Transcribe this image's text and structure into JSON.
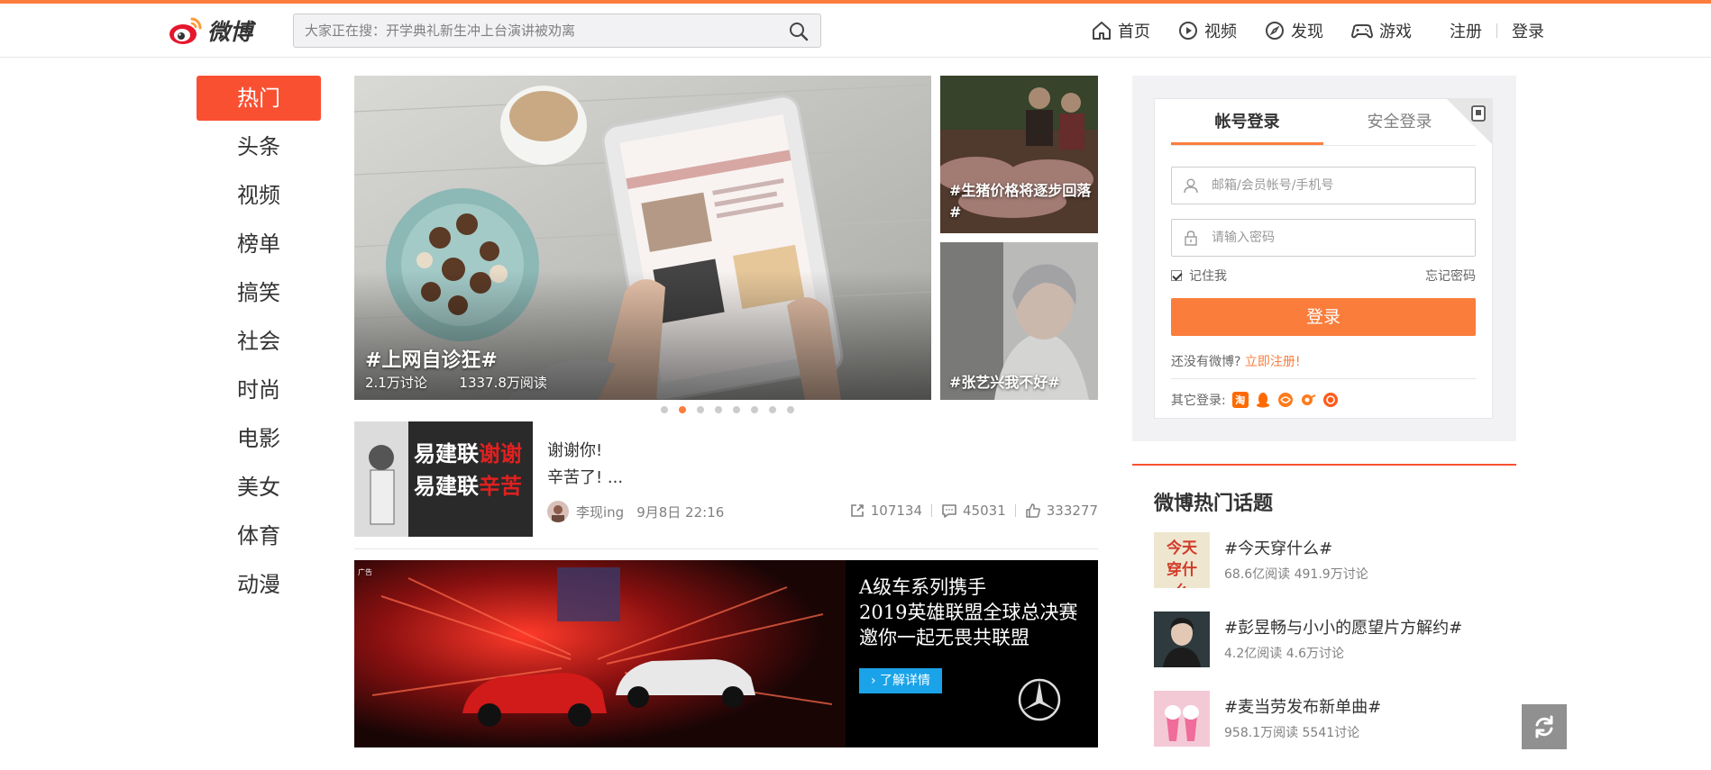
{
  "brand": {
    "name": "微博",
    "accent": "#fa7d3c",
    "hot_red": "#fa5032"
  },
  "search": {
    "placeholder": "大家正在搜：开学典礼新生冲上台演讲被劝离"
  },
  "nav": {
    "items": [
      {
        "label": "首页",
        "icon": "home-icon"
      },
      {
        "label": "视频",
        "icon": "video-icon"
      },
      {
        "label": "发现",
        "icon": "compass-icon"
      },
      {
        "label": "游戏",
        "icon": "gamepad-icon"
      }
    ],
    "register": "注册",
    "login": "登录"
  },
  "leftnav": [
    "热门",
    "头条",
    "视频",
    "榜单",
    "搞笑",
    "社会",
    "时尚",
    "电影",
    "美女",
    "体育",
    "动漫"
  ],
  "feature": {
    "main": {
      "title": "#上网自诊狂#",
      "discuss": "2.1万讨论",
      "reads": "1337.8万阅读"
    },
    "side1": {
      "title": "#生猪价格将逐步回落#"
    },
    "side2": {
      "title": "#张艺兴我不好#"
    },
    "dots_total": 8,
    "dots_active": 1
  },
  "feed": {
    "thumb_lines": [
      "易建联",
      "谢谢",
      "易建联",
      "辛苦"
    ],
    "line1": "谢谢你!",
    "line2": "辛苦了! ...",
    "author": "李现ing",
    "time": "9月8日 22:16",
    "reposts": "107134",
    "comments": "45031",
    "likes": "333277"
  },
  "ad": {
    "label": "广告",
    "line1": "A级车系列携手",
    "line2": "2019英雄联盟全球总决赛",
    "line3": "邀你一起无畏共联盟",
    "button": "› 了解详情"
  },
  "login": {
    "tab_account": "帐号登录",
    "tab_secure": "安全登录",
    "username_placeholder": "邮箱/会员帐号/手机号",
    "password_placeholder": "请输入密码",
    "remember": "记住我",
    "forgot": "忘记密码",
    "submit": "登录",
    "no_account": "还没有微博?",
    "register_now": "立即注册!",
    "other_label": "其它登录:",
    "taobao": "淘"
  },
  "hot_topics": {
    "title": "微博热门话题",
    "items": [
      {
        "name": "#今天穿什么#",
        "stats": "68.6亿阅读 491.9万讨论",
        "thumb_text": "今天穿什么"
      },
      {
        "name": "#彭昱畅与小小的愿望片方解约#",
        "stats": "4.2亿阅读 4.6万讨论"
      },
      {
        "name": "#麦当劳发布新单曲#",
        "stats": "958.1万阅读 5541讨论"
      }
    ]
  }
}
